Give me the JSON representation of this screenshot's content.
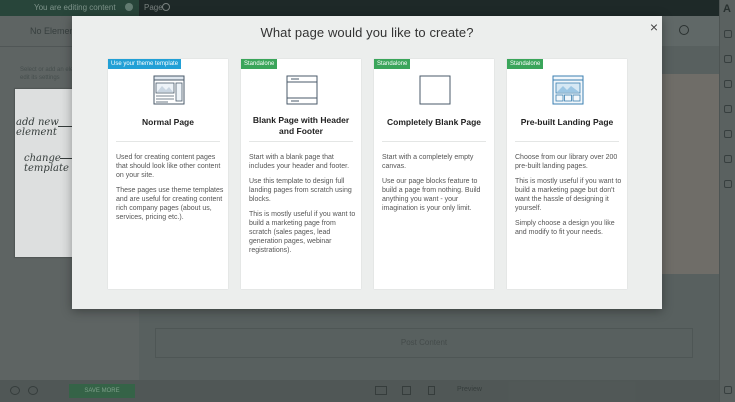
{
  "topbar": {
    "editing_text": "You are editing content",
    "page_label": "Page"
  },
  "sidebar": {
    "no_elements": "No Elements",
    "hint": "Select or add an element to edit its settings",
    "sketch_add": "add new element",
    "sketch_change": "change template"
  },
  "main": {
    "post_content": "Post Content"
  },
  "bottombar": {
    "save_label": "SAVE MORE",
    "preview_label": "Preview"
  },
  "modal": {
    "title": "What page would you like to create?",
    "close": "×",
    "cards": [
      {
        "badge": "Use your theme template",
        "badge_color": "#22a0d6",
        "icon": "normal-page-icon",
        "title": "Normal Page",
        "desc": [
          "Used for creating content pages that should look like other content on your site.",
          "These pages use theme templates and are useful for creating content rich company pages (about us, services, pricing etc.)."
        ]
      },
      {
        "badge": "Standalone",
        "badge_color": "#3aa55a",
        "icon": "header-footer-page-icon",
        "title": "Blank Page with Header and Footer",
        "desc": [
          "Start with a blank page that includes your header and footer.",
          "Use this template to design full landing pages from scratch using blocks.",
          "This is mostly useful if you want to build a marketing page from scratch (sales pages, lead generation pages, webinar registrations)."
        ]
      },
      {
        "badge": "Standalone",
        "badge_color": "#3aa55a",
        "icon": "blank-page-icon",
        "title": "Completely Blank Page",
        "desc": [
          "Start with a completely empty canvas.",
          "Use our page blocks feature to build a page from nothing. Build anything you want - your imagination is your only limit."
        ]
      },
      {
        "badge": "Standalone",
        "badge_color": "#3aa55a",
        "icon": "landing-page-icon",
        "title": "Pre-built Landing Page",
        "desc": [
          "Choose from our library over 200 pre-built landing pages.",
          "This is mostly useful if you want to build a marketing page but don't want the hassle of designing it yourself.",
          "Simply choose a design you like and modify to fit your needs."
        ]
      }
    ]
  }
}
